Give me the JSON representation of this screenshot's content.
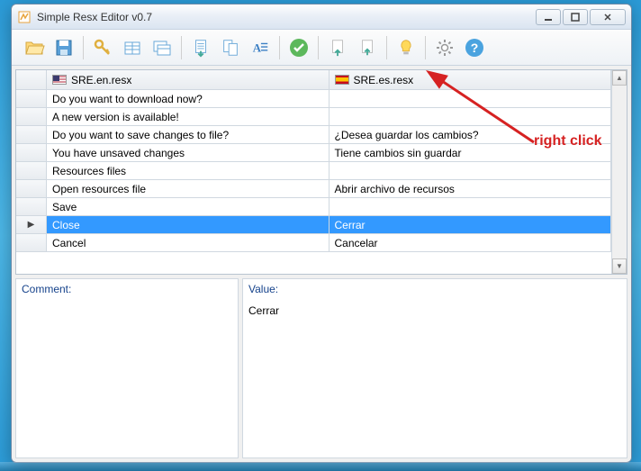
{
  "window": {
    "title": "Simple Resx Editor v0.7"
  },
  "columns": {
    "en": "SRE.en.resx",
    "es": "SRE.es.resx"
  },
  "rows": [
    {
      "en": "Do you want to download now?",
      "es": ""
    },
    {
      "en": "A new version is available!",
      "es": ""
    },
    {
      "en": "Do you want to save changes to file?",
      "es": "¿Desea guardar los cambios?"
    },
    {
      "en": "You have unsaved changes",
      "es": "Tiene cambios sin guardar"
    },
    {
      "en": "Resources files",
      "es": ""
    },
    {
      "en": "Open resources file",
      "es": "Abrir archivo de recursos"
    },
    {
      "en": "Save",
      "es": ""
    },
    {
      "en": "Close",
      "es": "Cerrar",
      "selected": true,
      "current": true
    },
    {
      "en": "Cancel",
      "es": "Cancelar"
    }
  ],
  "panes": {
    "commentLabel": "Comment:",
    "valueLabel": "Value:",
    "value": "Cerrar"
  },
  "annotation": "right click"
}
